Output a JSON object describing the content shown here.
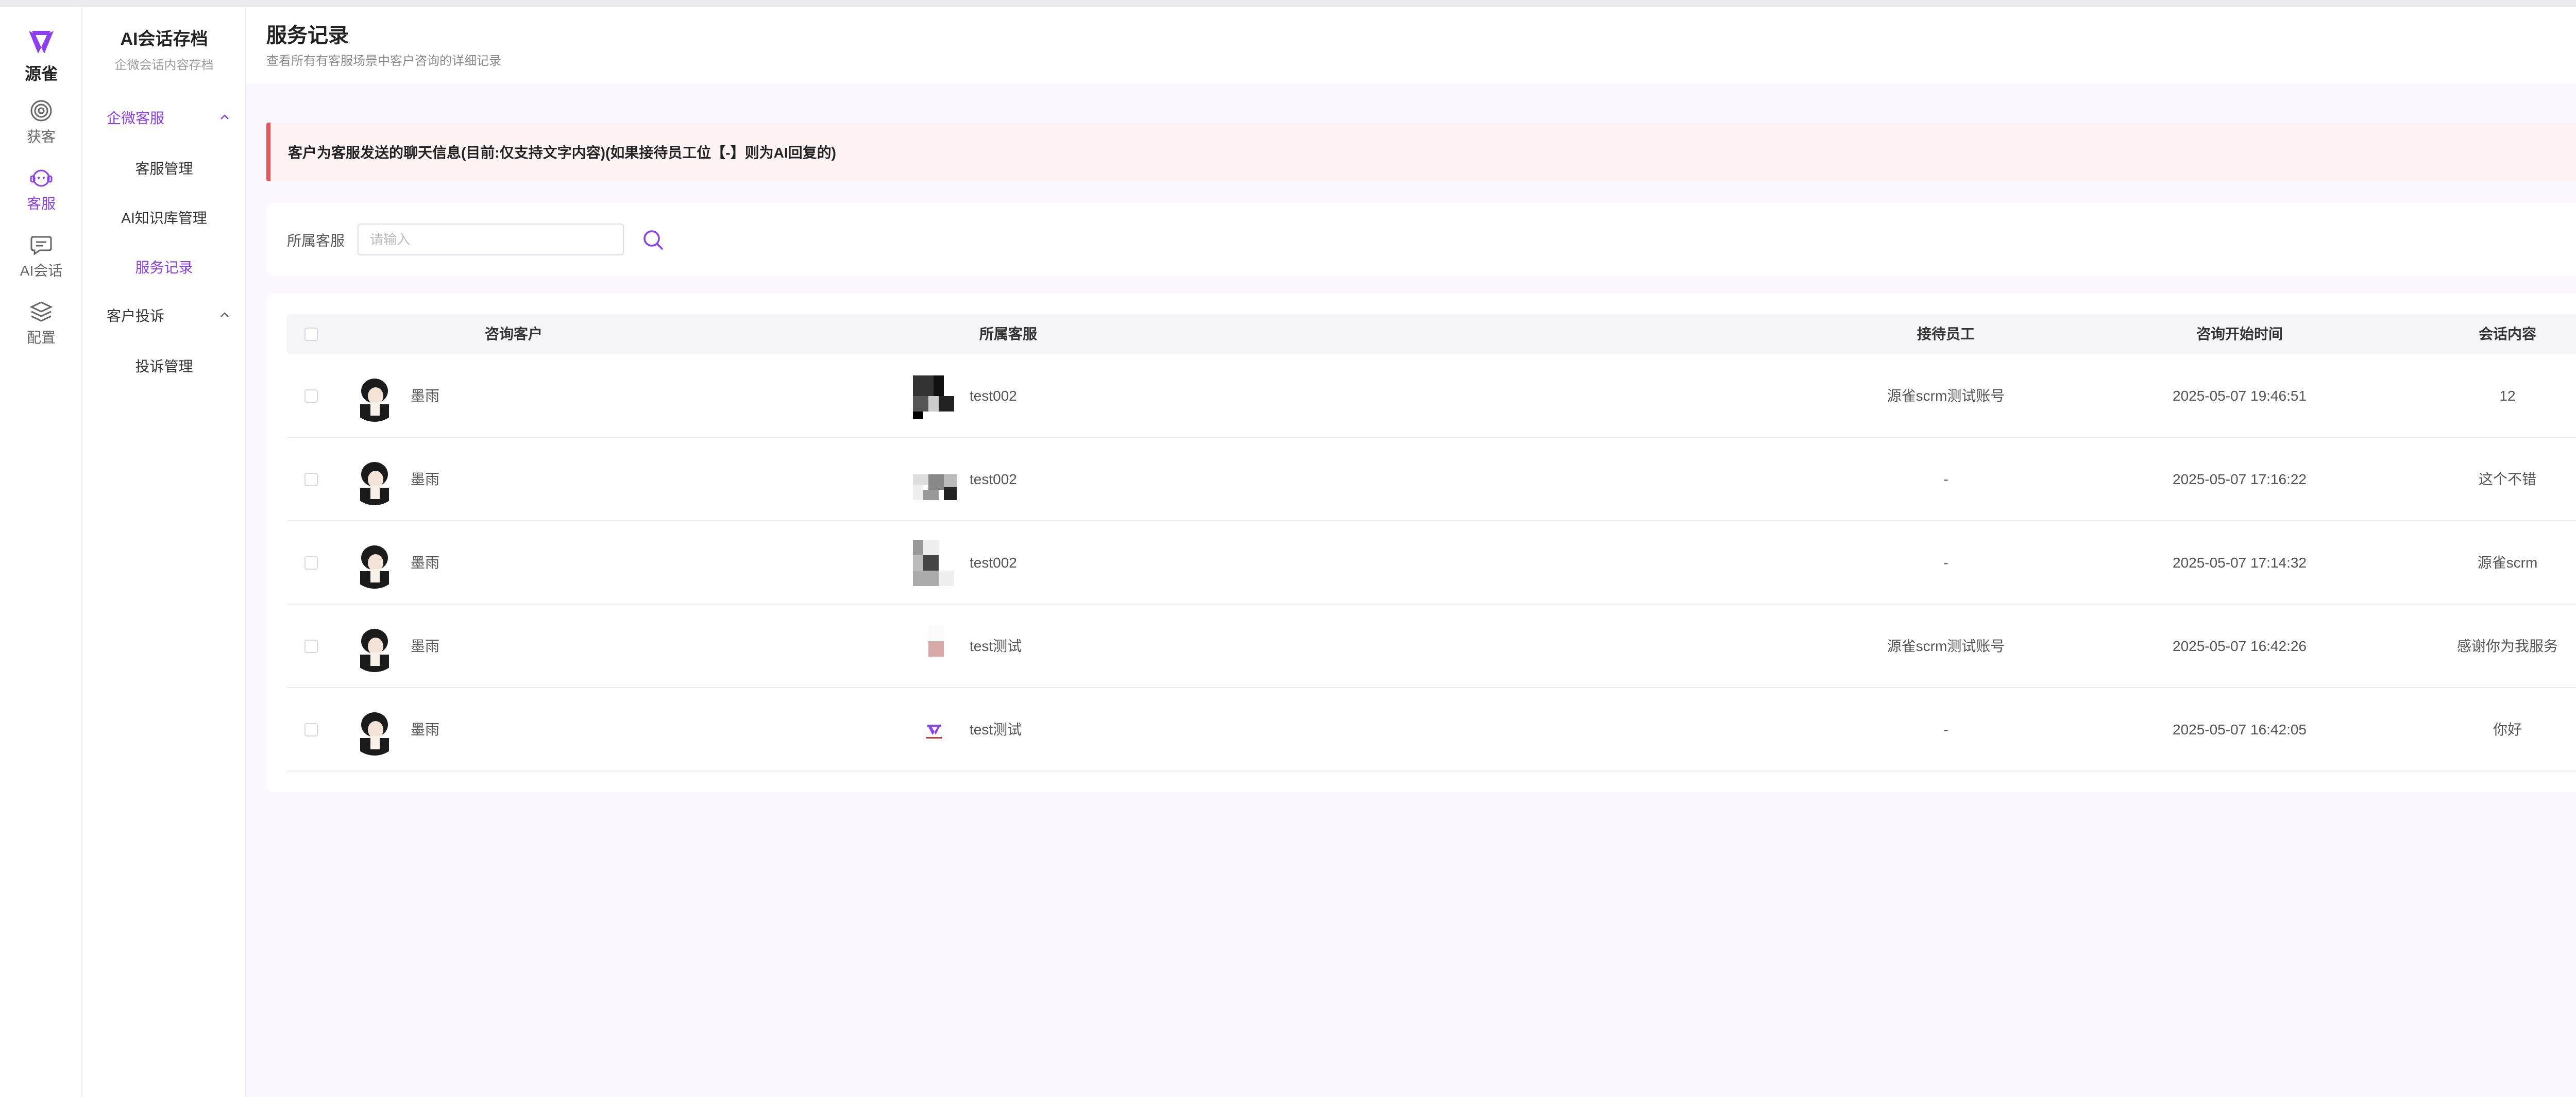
{
  "app": {
    "logo_text": "源雀",
    "brand_color": "#8a3ff0",
    "rail": [
      {
        "label": "获客",
        "icon": "target-icon"
      },
      {
        "label": "客服",
        "icon": "support-icon"
      },
      {
        "label": "AI会话",
        "icon": "chat-icon"
      },
      {
        "label": "配置",
        "icon": "layers-icon"
      }
    ]
  },
  "sidebar": {
    "title": "AI会话存档",
    "subtitle": "企微会话内容存档",
    "group1": "企微客服",
    "items1": [
      "客服管理",
      "AI知识库管理",
      "服务记录"
    ],
    "group2": "客户投诉",
    "items2": [
      "投诉管理"
    ]
  },
  "header": {
    "title": "服务记录",
    "subtitle": "查看所有有客服场景中客户咨询的详细记录"
  },
  "notice": "客户为客服发送的聊天信息(目前:仅支持文字内容)(如果接待员工位【-】则为AI回复的)",
  "filter": {
    "label": "所属客服",
    "placeholder": "请输入"
  },
  "table": {
    "columns": [
      "咨询客户",
      "所属客服",
      "接待员工",
      "咨询开始时间",
      "会话内容"
    ],
    "rows": [
      {
        "customer": "墨雨",
        "service": "test002",
        "staff": "源雀scrm测试账号",
        "time": "2025-05-07 19:46:51",
        "content": "12"
      },
      {
        "customer": "墨雨",
        "service": "test002",
        "staff": "-",
        "time": "2025-05-07 17:16:22",
        "content": "这个不错"
      },
      {
        "customer": "墨雨",
        "service": "test002",
        "staff": "-",
        "time": "2025-05-07 17:14:32",
        "content": "源雀scrm"
      },
      {
        "customer": "墨雨",
        "service": "test测试",
        "staff": "源雀scrm测试账号",
        "time": "2025-05-07 16:42:26",
        "content": "感谢你为我服务"
      },
      {
        "customer": "墨雨",
        "service": "test测试",
        "staff": "-",
        "time": "2025-05-07 16:42:05",
        "content": "你好"
      }
    ]
  }
}
